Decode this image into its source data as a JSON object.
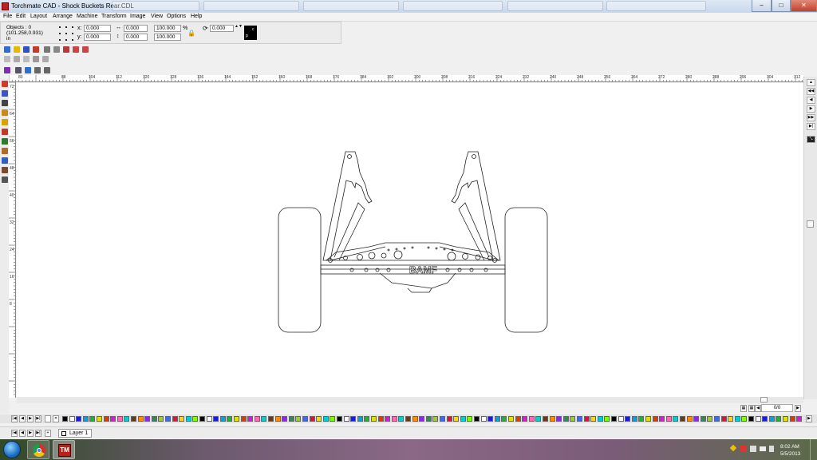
{
  "window": {
    "title": "Torchmate CAD - Shock Buckets Rear.CDL",
    "minimize": "–",
    "maximize": "□",
    "close": "✕"
  },
  "menu": [
    "File",
    "Edit",
    "Layout",
    "Arrange",
    "Machine",
    "Transform",
    "Image",
    "View",
    "Options",
    "Help"
  ],
  "properties": {
    "objects": "Objects : 0",
    "coords": "(101.258,0.931)",
    "units": "in",
    "x_label": "x:",
    "x_value": "0.000",
    "y_label": "y:",
    "y_value": "0.000",
    "width_value": "0.000",
    "height_value": "0.000",
    "scale_x": "100.000",
    "scale_y": "100.000",
    "percent": "%",
    "rotation": "0.000",
    "swatch_c": "c",
    "swatch_p": "p"
  },
  "ruler": {
    "horizontal": [
      "80",
      "88",
      "104",
      "112",
      "120",
      "128",
      "136",
      "144",
      "152",
      "160",
      "168",
      "176",
      "184",
      "192",
      "200",
      "208",
      "216",
      "224",
      "232",
      "240",
      "248",
      "256",
      "264",
      "272",
      "280",
      "288",
      "296",
      "304",
      "312"
    ],
    "vertical": [
      "72",
      "64",
      "56",
      "48",
      "40",
      "32",
      "24",
      "16",
      "8"
    ]
  },
  "drawing": {
    "logo_text": "BAMF"
  },
  "status": {
    "page_counter": "0/0"
  },
  "layer": {
    "name": "Layer 1"
  },
  "taskbar": {
    "time": "8:02 AM",
    "date": "5/5/2013",
    "tm_label": "TM"
  },
  "palette_colors": [
    "#000000",
    "#ffffff",
    "#1b1bd6",
    "#00a3e0",
    "#1cb532",
    "#e0e000",
    "#e03c00",
    "#d81ad8",
    "#ff69b4",
    "#14c8c8",
    "#6b3a10",
    "#ff8c00",
    "#8a2be2",
    "#2e8b57",
    "#9acd32",
    "#4169e1",
    "#dc143c",
    "#ffd700",
    "#00ced1",
    "#7cfc00"
  ]
}
